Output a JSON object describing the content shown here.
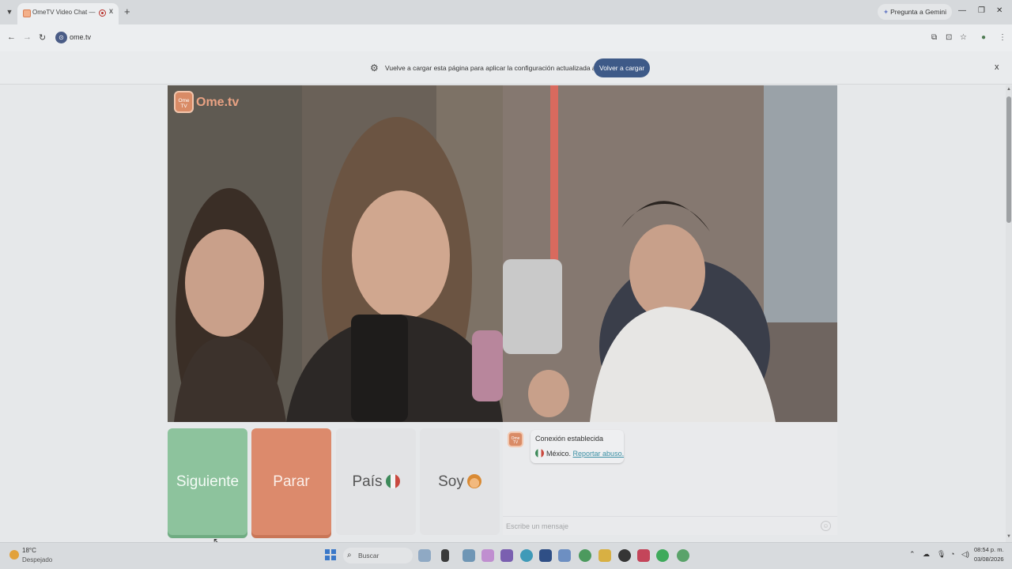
{
  "browser": {
    "tab_title": "OmeTV Video Chat — Ome",
    "tab_close": "x",
    "new_tab": "+",
    "gemini_label": "Pregunta a Gemini",
    "url": "ome.tv",
    "infobar_message": "Vuelve a cargar esta página para aplicar la configuración actualizada a este sitio",
    "infobar_button": "Volver a cargar",
    "infobar_close": "x"
  },
  "page": {
    "logo_badge": "Ome TV",
    "logo_text": "Ome.tv",
    "buttons": {
      "next": "Siguiente",
      "stop": "Parar",
      "country": "País",
      "gender": "Soy"
    },
    "chat": {
      "badge": "Ome TV",
      "title": "Conexión establecida",
      "country": "México.",
      "report_link": "Reportar abuso.",
      "input_placeholder": "Escribe un mensaje"
    }
  },
  "taskbar": {
    "weather_temp": "18°C",
    "weather_desc": "Despejado",
    "search_placeholder": "Buscar",
    "time": "08:54 p. m.",
    "date": "03/08/2026"
  },
  "icons": {
    "tab_search": "chevron-down-icon",
    "favicon": "ometv-favicon-icon",
    "recording": "recording-indicator-icon",
    "back": "back-arrow-icon",
    "forward": "forward-arrow-icon",
    "reload": "reload-icon",
    "settings": "gear-icon",
    "cursor": "mouse-pointer-icon"
  },
  "colors": {
    "next_button": "#8dc39d",
    "stop_button": "#dc8a6c",
    "reload_button": "#3e5a88",
    "brand_orange": "#d98b66"
  }
}
